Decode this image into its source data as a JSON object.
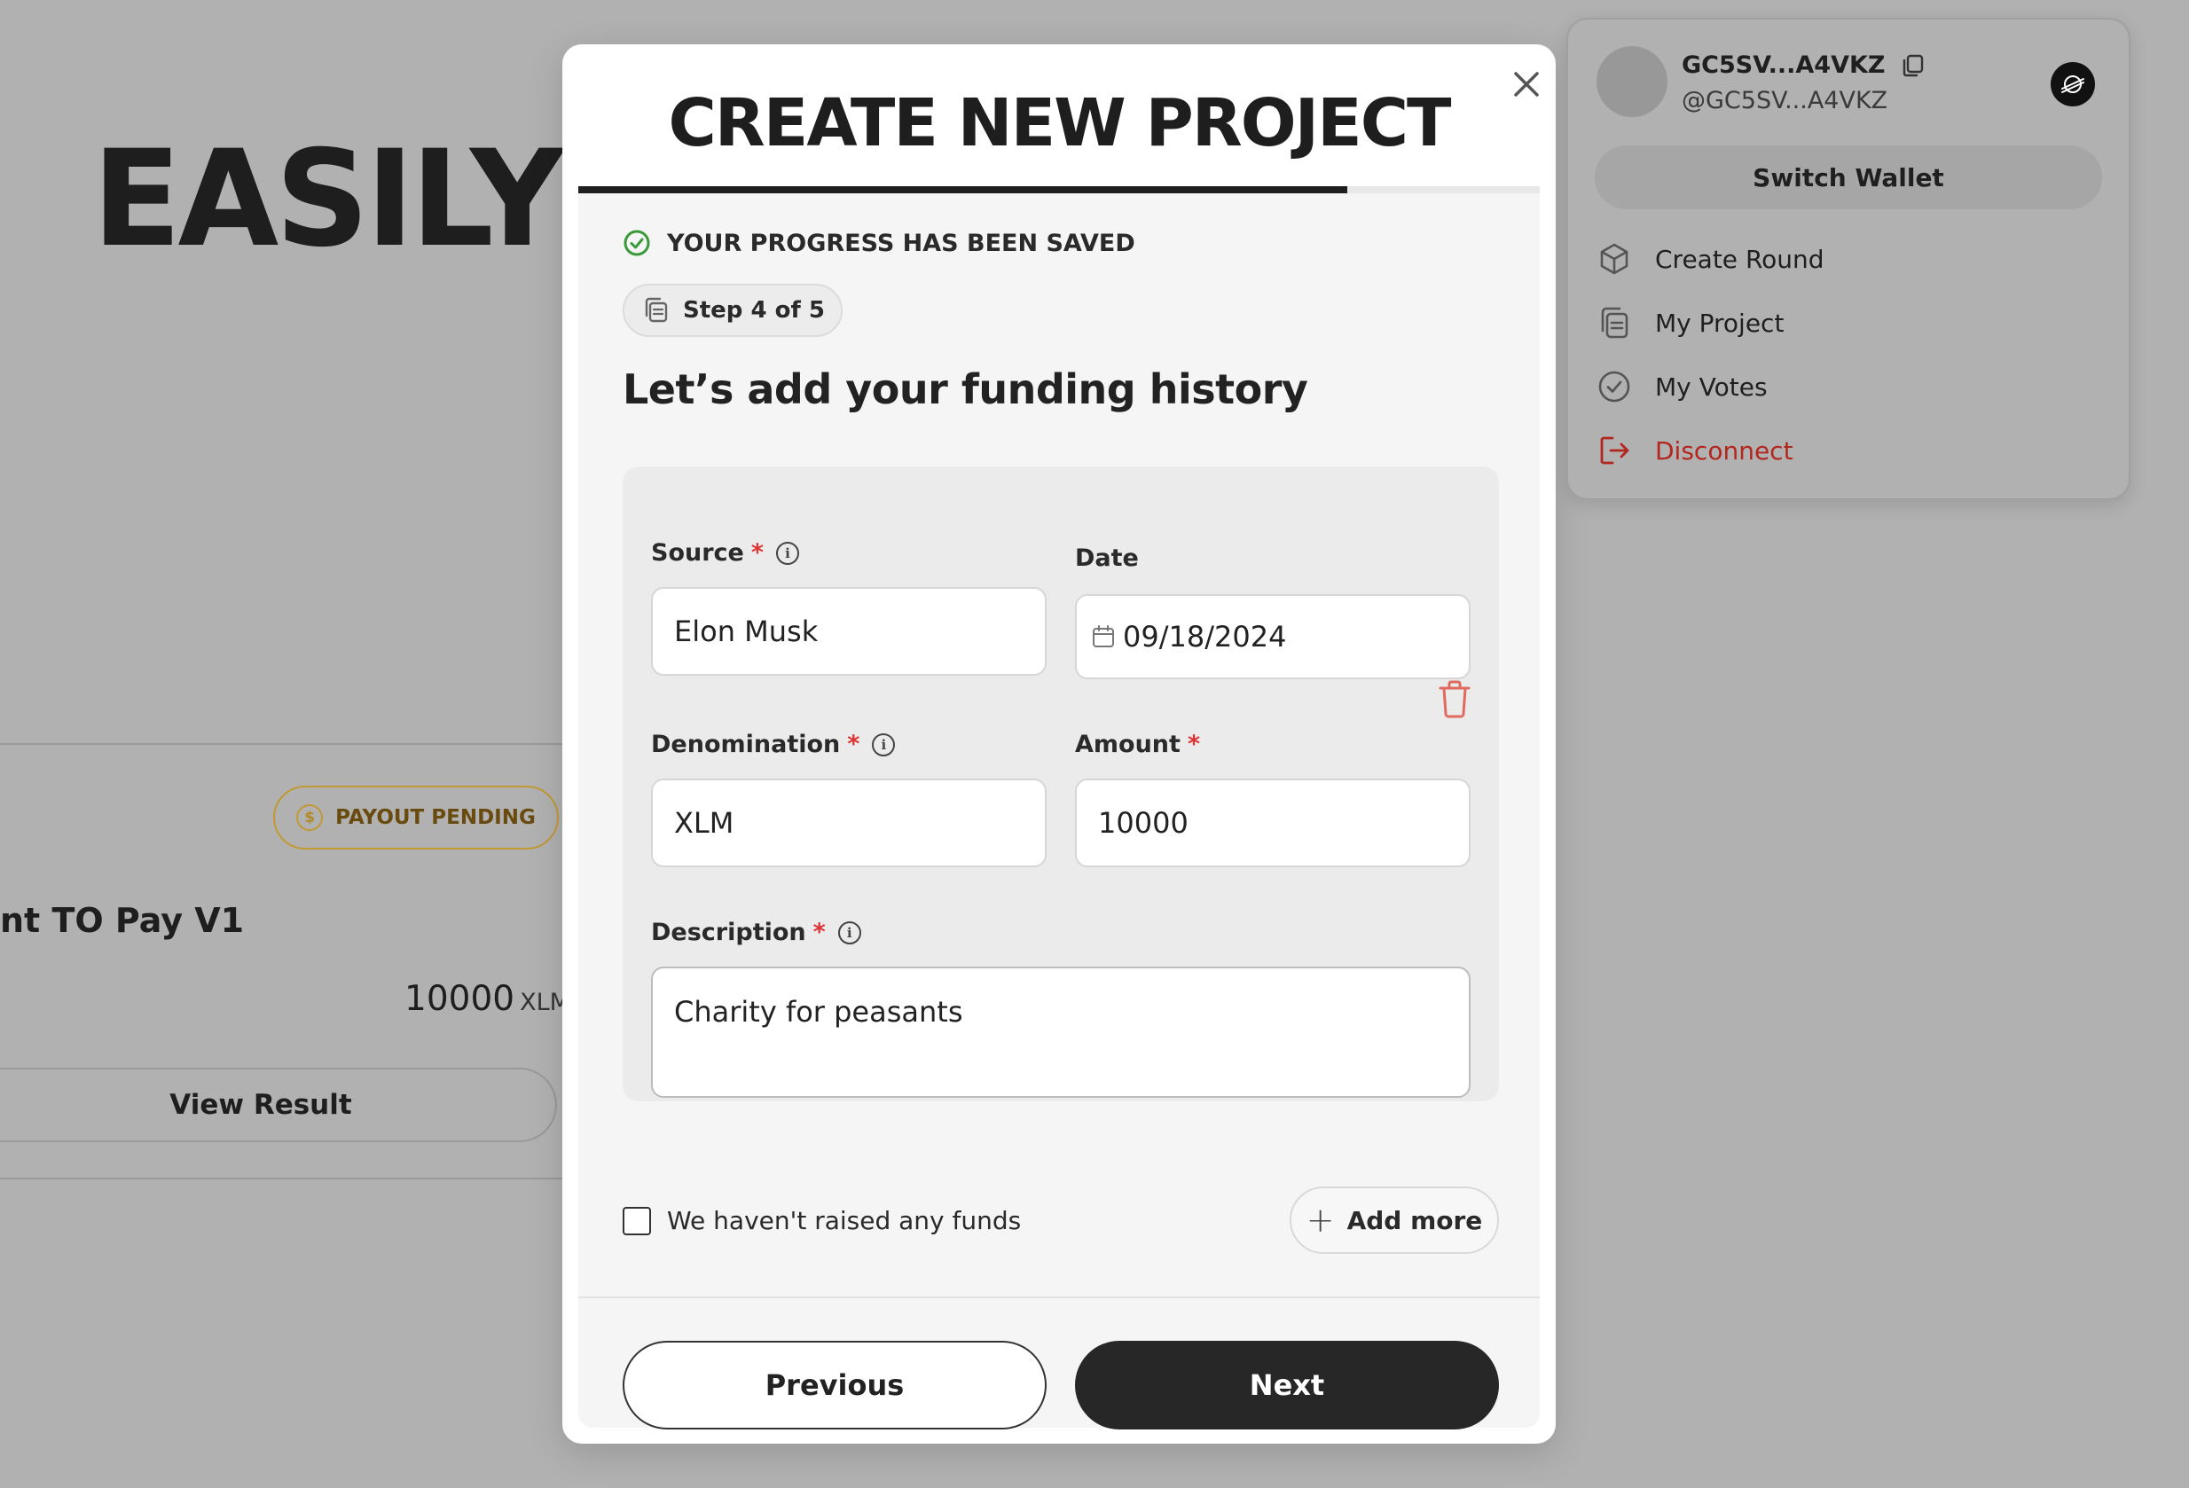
{
  "background": {
    "hero_title": "EASILY I",
    "badge_label": "PAYOUT PENDING",
    "card_title": "nt TO Pay V1",
    "amount_value": "10000",
    "amount_unit": "XLM",
    "view_button": "View Result"
  },
  "modal": {
    "title": "CREATE NEW PROJECT",
    "progress": 0.8,
    "saved_text": "YOUR PROGRESS HAS BEEN SAVED",
    "step_label": "Step 4 of 5",
    "heading": "Let’s add your funding history",
    "fields": {
      "source": {
        "label": "Source",
        "required": "*",
        "value": "Elon Musk"
      },
      "date": {
        "label": "Date",
        "value": "09/18/2024"
      },
      "denomination": {
        "label": "Denomination",
        "required": "*",
        "value": "XLM"
      },
      "amount": {
        "label": "Amount",
        "required": "*",
        "value": "10000"
      },
      "description": {
        "label": "Description",
        "required": "*",
        "value": "Charity for peasants"
      }
    },
    "no_funds_label": "We haven't raised any funds",
    "add_more_label": "Add more",
    "previous_label": "Previous",
    "next_label": "Next"
  },
  "wallet": {
    "address": "GC5SV...A4VKZ",
    "handle": "@GC5SV...A4VKZ",
    "switch_label": "Switch Wallet",
    "menu": [
      {
        "label": "Create Round",
        "icon": "cube-icon"
      },
      {
        "label": "My Project",
        "icon": "documents-icon"
      },
      {
        "label": "My Votes",
        "icon": "check-circle-icon"
      },
      {
        "label": "Disconnect",
        "icon": "logout-icon"
      }
    ]
  },
  "colors": {
    "accent_dark": "#272727",
    "required": "#dd3333",
    "success": "#3a9a3a",
    "danger": "#b3261e",
    "badge_gold": "#c19a35"
  }
}
